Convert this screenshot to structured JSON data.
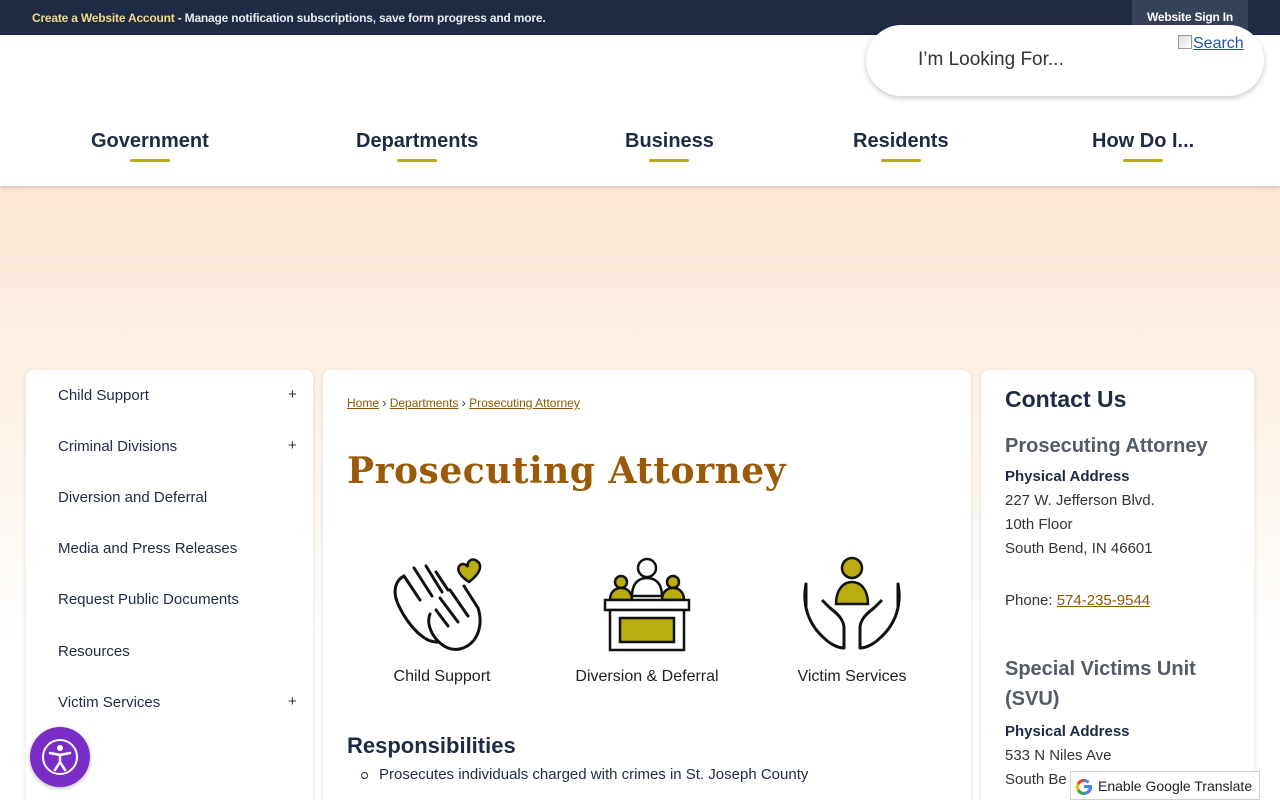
{
  "topbar": {
    "create_link": "Create a Website Account",
    "message": " - Manage notification subscriptions, save form progress and more.",
    "signin_label": "Website Sign In"
  },
  "search": {
    "placeholder": "I’m Looking For...",
    "button_label": "Search"
  },
  "nav": {
    "items": [
      "Government",
      "Departments",
      "Business",
      "Residents",
      "How Do I..."
    ]
  },
  "sidebar": {
    "items": [
      {
        "label": "Child Support",
        "expandable": "+"
      },
      {
        "label": "Criminal Divisions",
        "expandable": "+"
      },
      {
        "label": "Diversion and Deferral"
      },
      {
        "label": "Media and Press Releases"
      },
      {
        "label": "Request Public Documents"
      },
      {
        "label": "Resources"
      },
      {
        "label": "Victim Services",
        "expandable": "+"
      }
    ]
  },
  "breadcrumb": {
    "home": "Home",
    "sep": "›",
    "departments": "Departments",
    "current": "Prosecuting Attorney"
  },
  "main": {
    "title": "Prosecuting Attorney",
    "tiles": [
      {
        "label": "Child Support",
        "icon": "hands-heart-icon"
      },
      {
        "label": "Diversion & Deferral",
        "icon": "courtroom-icon"
      },
      {
        "label": "Victim Services",
        "icon": "hands-person-icon"
      }
    ],
    "responsibilities_title": "Responsibilities",
    "responsibilities": [
      "Prosecutes individuals charged with crimes in St. Joseph County"
    ]
  },
  "contact": {
    "title": "Contact Us",
    "sections": [
      {
        "name": "Prosecuting Attorney",
        "address_label": "Physical Address",
        "address_lines": [
          "227 W. Jefferson Blvd.",
          "10th Floor",
          "South Bend, IN 46601"
        ],
        "phone_label": "Phone: ",
        "phone": "574-235-9544"
      },
      {
        "name": "Special Victims Unit (SVU)",
        "address_label": "Physical Address",
        "address_lines": [
          "533 N Niles Ave",
          "South Be"
        ]
      }
    ]
  },
  "widgets": {
    "translate_label": "Enable Google Translate"
  },
  "colors": {
    "topbar": "#1f2b45",
    "accent_gold": "#b9ad10",
    "title_brown": "#9b5a07",
    "link_brown": "#8a5a00",
    "a11y_purple": "#7a2cc7"
  }
}
